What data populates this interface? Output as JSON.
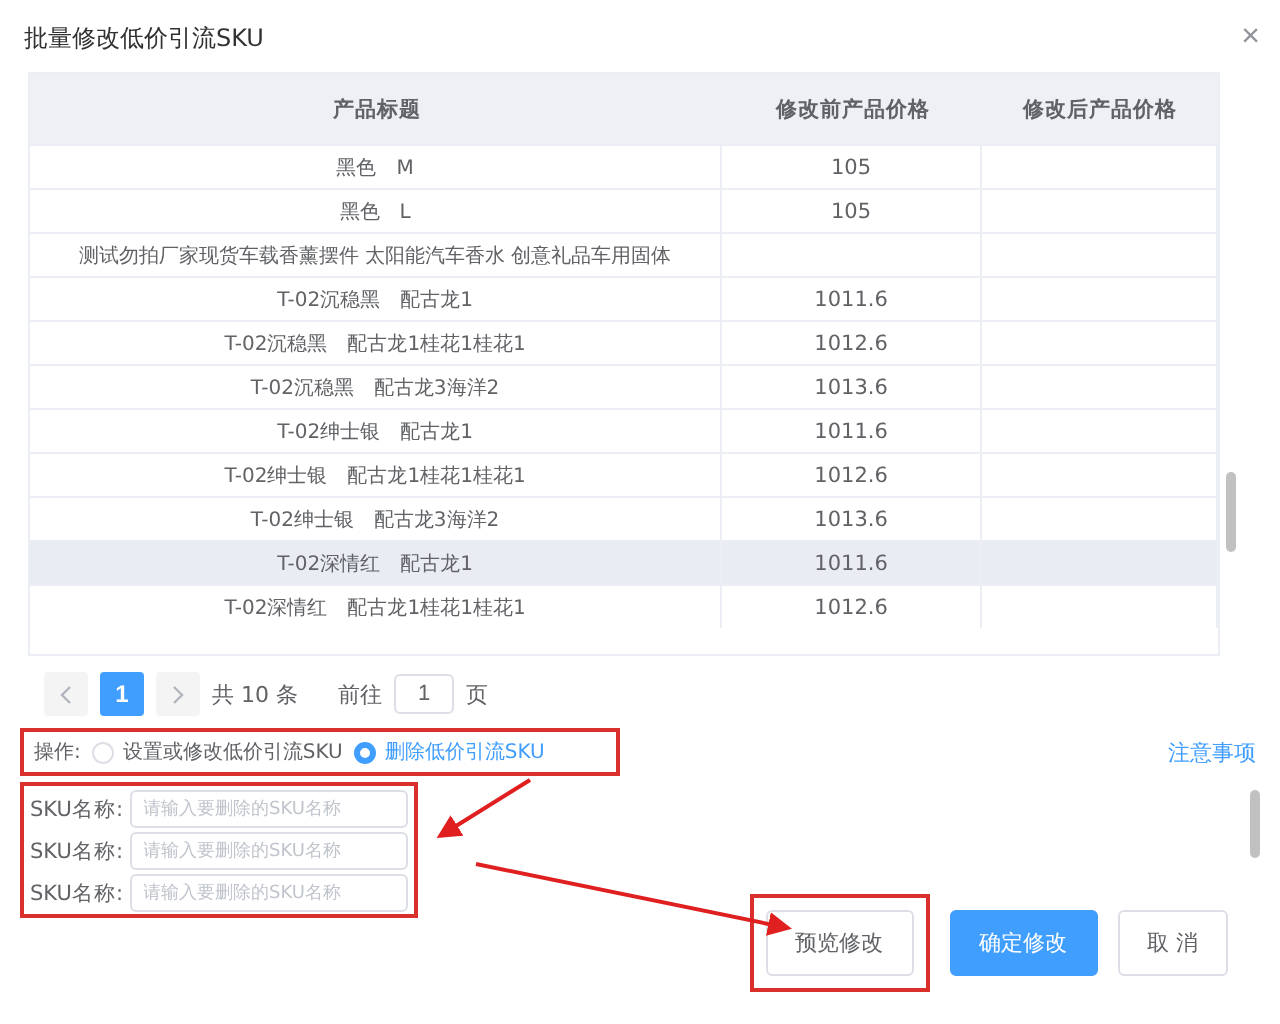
{
  "dialog": {
    "title": "批量修改低价引流SKU",
    "close": "×"
  },
  "table": {
    "columns": [
      "产品标题",
      "修改前产品价格",
      "修改后产品价格"
    ],
    "rows": [
      {
        "title": "黑色　M",
        "price_before": "105",
        "hovered": false
      },
      {
        "title": "黑色　L",
        "price_before": "105",
        "hovered": false
      },
      {
        "title": "测试勿拍厂家现货车载香薰摆件 太阳能汽车香水 创意礼品车用固体",
        "hovered": false
      },
      {
        "title": "T-02沉稳黑　配古龙1",
        "price_before": "1011.6",
        "hovered": false
      },
      {
        "title": "T-02沉稳黑　配古龙1桂花1桂花1",
        "price_before": "1012.6",
        "hovered": false
      },
      {
        "title": "T-02沉稳黑　配古龙3海洋2",
        "price_before": "1013.6",
        "hovered": false
      },
      {
        "title": "T-02绅士银　配古龙1",
        "price_before": "1011.6",
        "hovered": false
      },
      {
        "title": "T-02绅士银　配古龙1桂花1桂花1",
        "price_before": "1012.6",
        "hovered": false
      },
      {
        "title": "T-02绅士银　配古龙3海洋2",
        "price_before": "1013.6",
        "hovered": false
      },
      {
        "title": "T-02深情红　配古龙1",
        "price_before": "1011.6",
        "hovered": true
      },
      {
        "title": "T-02深情红　配古龙1桂花1桂花1",
        "price_before": "1012.6",
        "hovered": false
      }
    ]
  },
  "pagination": {
    "pages": [
      {
        "label": "1",
        "selected": true
      }
    ],
    "total": "共 10 条",
    "goto_label": "前往",
    "goto_value": "1",
    "goto_suffix": "页"
  },
  "operation": {
    "label": "操作:",
    "options": [
      {
        "label": "设置或修改低价引流SKU",
        "selected": false
      },
      {
        "label": "删除低价引流SKU",
        "selected": true
      }
    ],
    "notes_link": "注意事项"
  },
  "sku_fields": [
    {
      "label": "SKU名称:",
      "placeholder": "请输入要删除的SKU名称"
    },
    {
      "label": "SKU名称:",
      "placeholder": "请输入要删除的SKU名称"
    },
    {
      "label": "SKU名称:",
      "placeholder": "请输入要删除的SKU名称"
    }
  ],
  "buttons": [
    {
      "label": "预览修改",
      "kind": "default"
    },
    {
      "label": "确定修改",
      "kind": "primary"
    },
    {
      "label": "取 消",
      "kind": "default"
    }
  ]
}
